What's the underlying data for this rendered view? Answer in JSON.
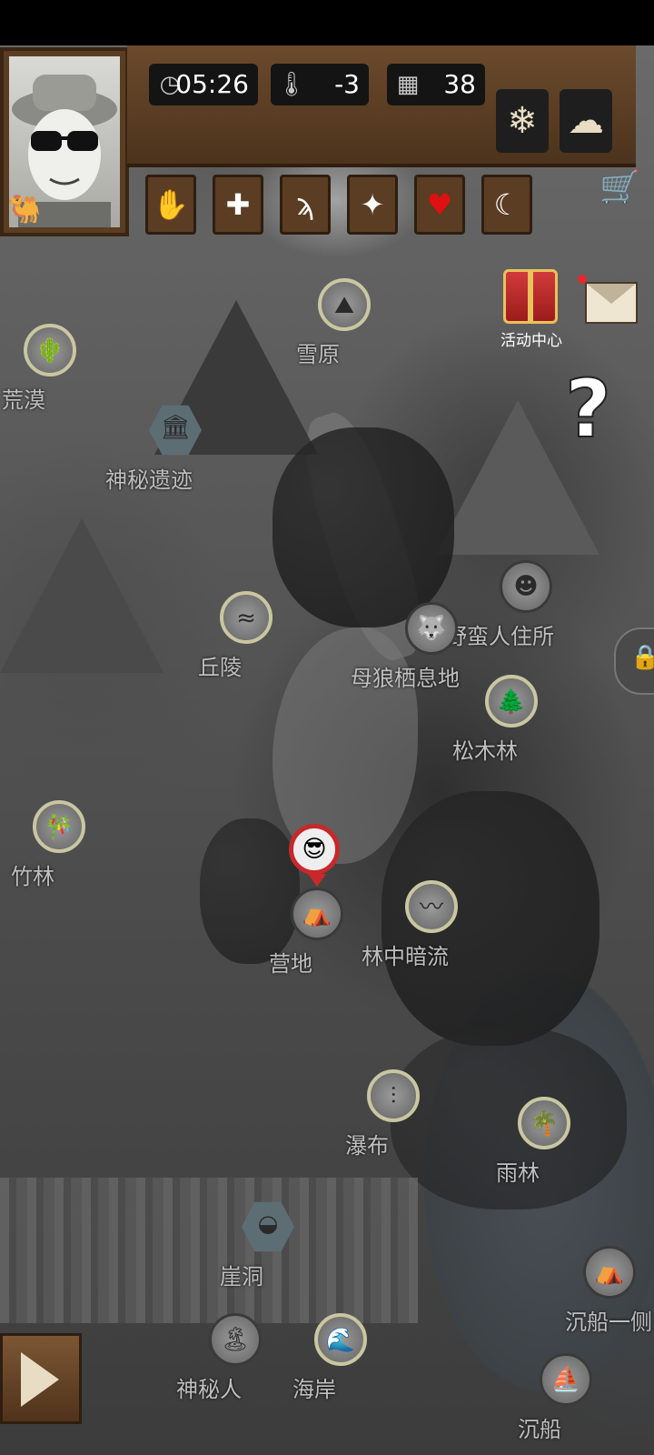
{
  "status": {
    "time": "05:26",
    "temperature": "-3",
    "day": "38",
    "icons": {
      "time": "clock-icon",
      "temperature": "thermometer-icon",
      "day": "calendar-icon"
    }
  },
  "weather_buttons": [
    "snowflake-icon",
    "cloud-icon"
  ],
  "action_buttons": [
    "hand-icon",
    "health-cross-icon",
    "stomach-icon",
    "mind-icon",
    "heart-icon",
    "moon-icon"
  ],
  "gift": {
    "label": "活动中心"
  },
  "help": {
    "glyph": "?"
  },
  "player": {
    "avatar": "😎"
  },
  "locations": [
    {
      "label": "荒漠",
      "icon": "cactus-icon",
      "glyph": "🌵"
    },
    {
      "label": "雪原",
      "icon": "snow-mountain-icon",
      "glyph": "⛰"
    },
    {
      "label": "神秘遗迹",
      "icon": "temple-icon",
      "glyph": "🏛"
    },
    {
      "label": "野蛮人住所",
      "icon": "native-chief-icon",
      "glyph": "☻"
    },
    {
      "label": "丘陵",
      "icon": "hills-icon",
      "glyph": "≈"
    },
    {
      "label": "母狼栖息地",
      "icon": "wolf-icon",
      "glyph": "🐺"
    },
    {
      "label": "松木林",
      "icon": "pine-forest-icon",
      "glyph": "🌲"
    },
    {
      "label": "竹林",
      "icon": "bamboo-icon",
      "glyph": "🎋"
    },
    {
      "label": "营地",
      "icon": "camp-icon",
      "glyph": "⛺"
    },
    {
      "label": "林中暗流",
      "icon": "stream-icon",
      "glyph": "〰"
    },
    {
      "label": "瀑布",
      "icon": "waterfall-icon",
      "glyph": "⫶"
    },
    {
      "label": "雨林",
      "icon": "rainforest-icon",
      "glyph": "🌴"
    },
    {
      "label": "崖洞",
      "icon": "cave-icon",
      "glyph": "◒"
    },
    {
      "label": "沉船一侧",
      "icon": "tent-icon",
      "glyph": "⛺"
    },
    {
      "label": "神秘人",
      "icon": "mystery-island-icon",
      "glyph": "🏝"
    },
    {
      "label": "海岸",
      "icon": "coast-icon",
      "glyph": "🌊"
    },
    {
      "label": "沉船",
      "icon": "shipwreck-icon",
      "glyph": "⛵"
    }
  ]
}
